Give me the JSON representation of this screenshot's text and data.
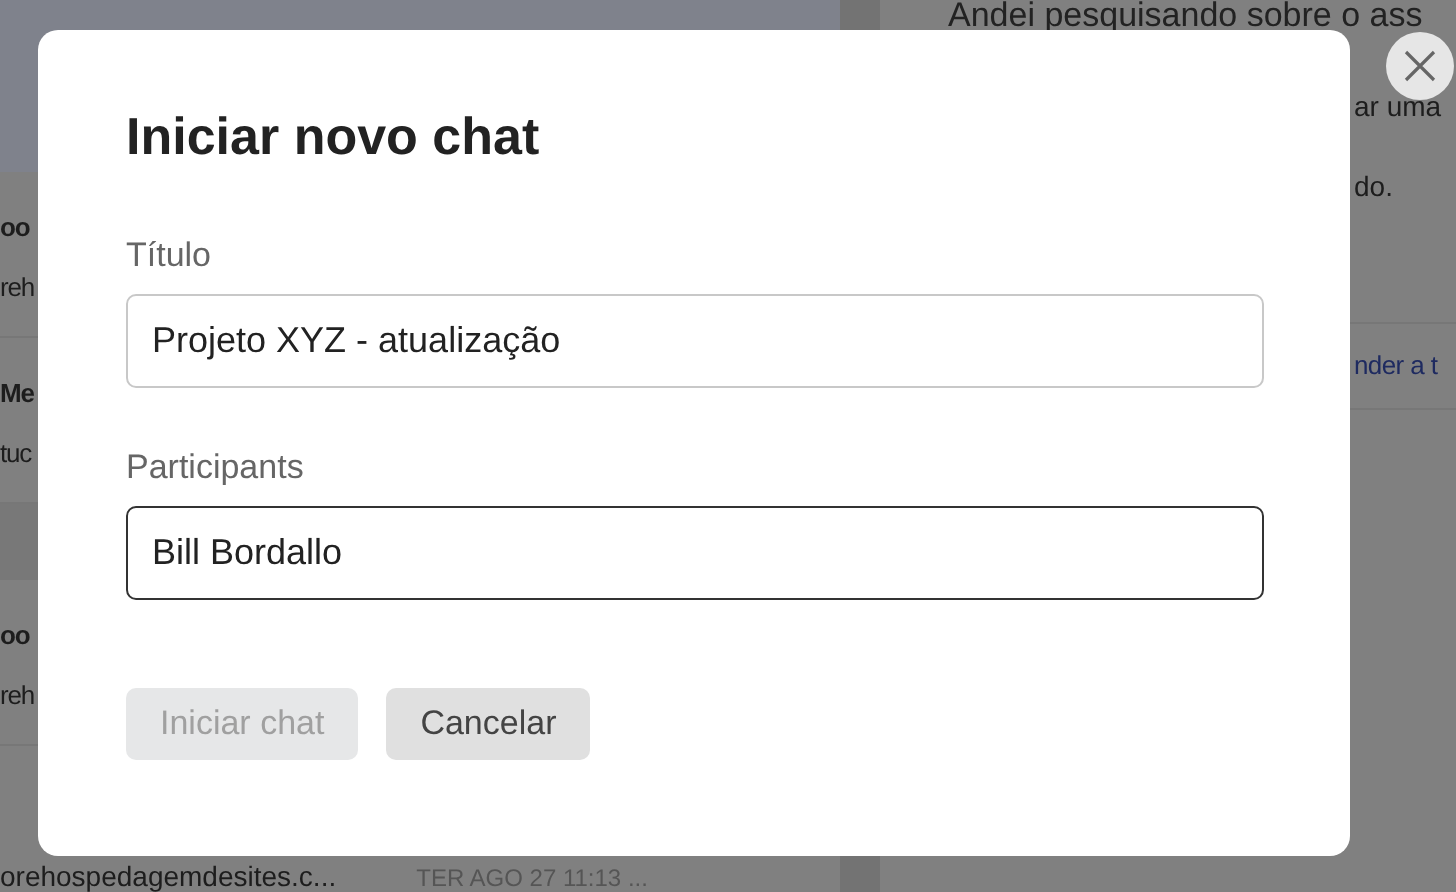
{
  "background": {
    "list_rows": [
      {
        "name": "oo",
        "preview": "reh"
      },
      {
        "name": "Me",
        "preview": "tuc"
      },
      {
        "name": "oo",
        "preview": "reh"
      }
    ],
    "last_row": {
      "preview": "orehospedagemdesites.c...",
      "time": "TER AGO 27 11:13 ..."
    },
    "message_lines": [
      "Andei pesquisando sobre o ass",
      "ar uma",
      "do."
    ],
    "reply_link": "nder a t"
  },
  "dialog": {
    "title": "Iniciar novo chat",
    "fields": [
      {
        "label": "Título",
        "value": "Projeto XYZ - atualização",
        "focused": false
      },
      {
        "label": "Participants",
        "value": "Bill Bordallo",
        "focused": true
      }
    ],
    "buttons": [
      {
        "label": "Iniciar chat",
        "disabled": true
      },
      {
        "label": "Cancelar",
        "disabled": false
      }
    ]
  }
}
